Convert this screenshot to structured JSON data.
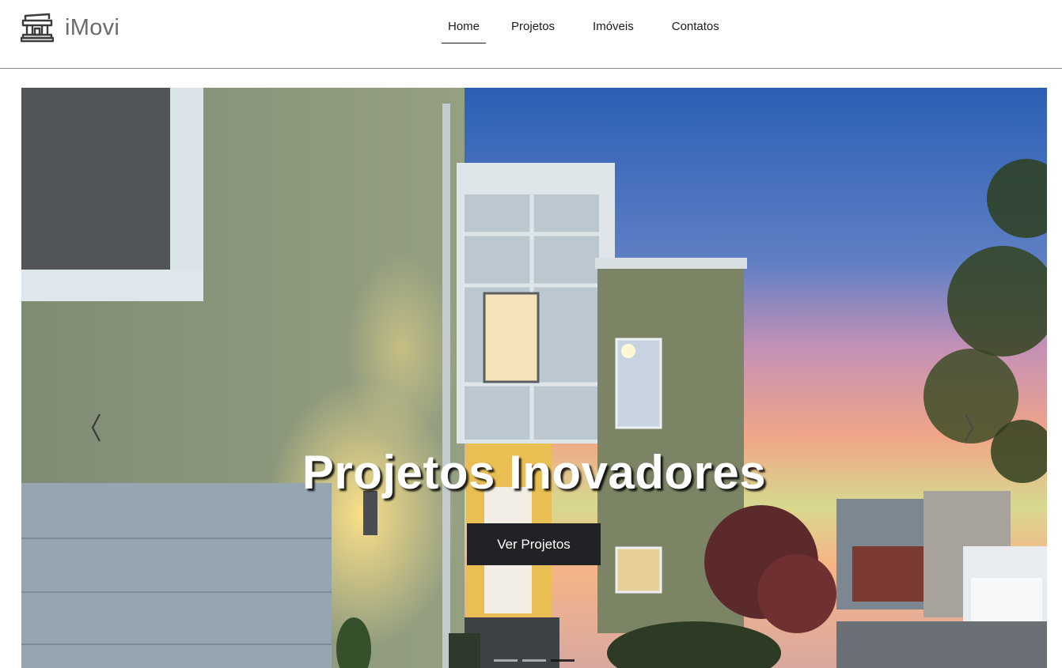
{
  "brand": {
    "name": "iMovi",
    "icon": "building-icon"
  },
  "nav": {
    "items": [
      {
        "label": "Home",
        "active": true
      },
      {
        "label": "Projetos",
        "active": false
      },
      {
        "label": "Imóveis",
        "active": false
      },
      {
        "label": "Contatos",
        "active": false
      }
    ]
  },
  "hero": {
    "title": "Projetos Inovadores",
    "button_label": "Ver Projetos",
    "prev_icon": "chevron-left-icon",
    "next_icon": "chevron-right-icon",
    "slides": 3,
    "active_slide": 3
  },
  "colors": {
    "button_bg": "#212226",
    "brand_text": "#6b6b6b",
    "header_border": "#8a8a8a"
  }
}
